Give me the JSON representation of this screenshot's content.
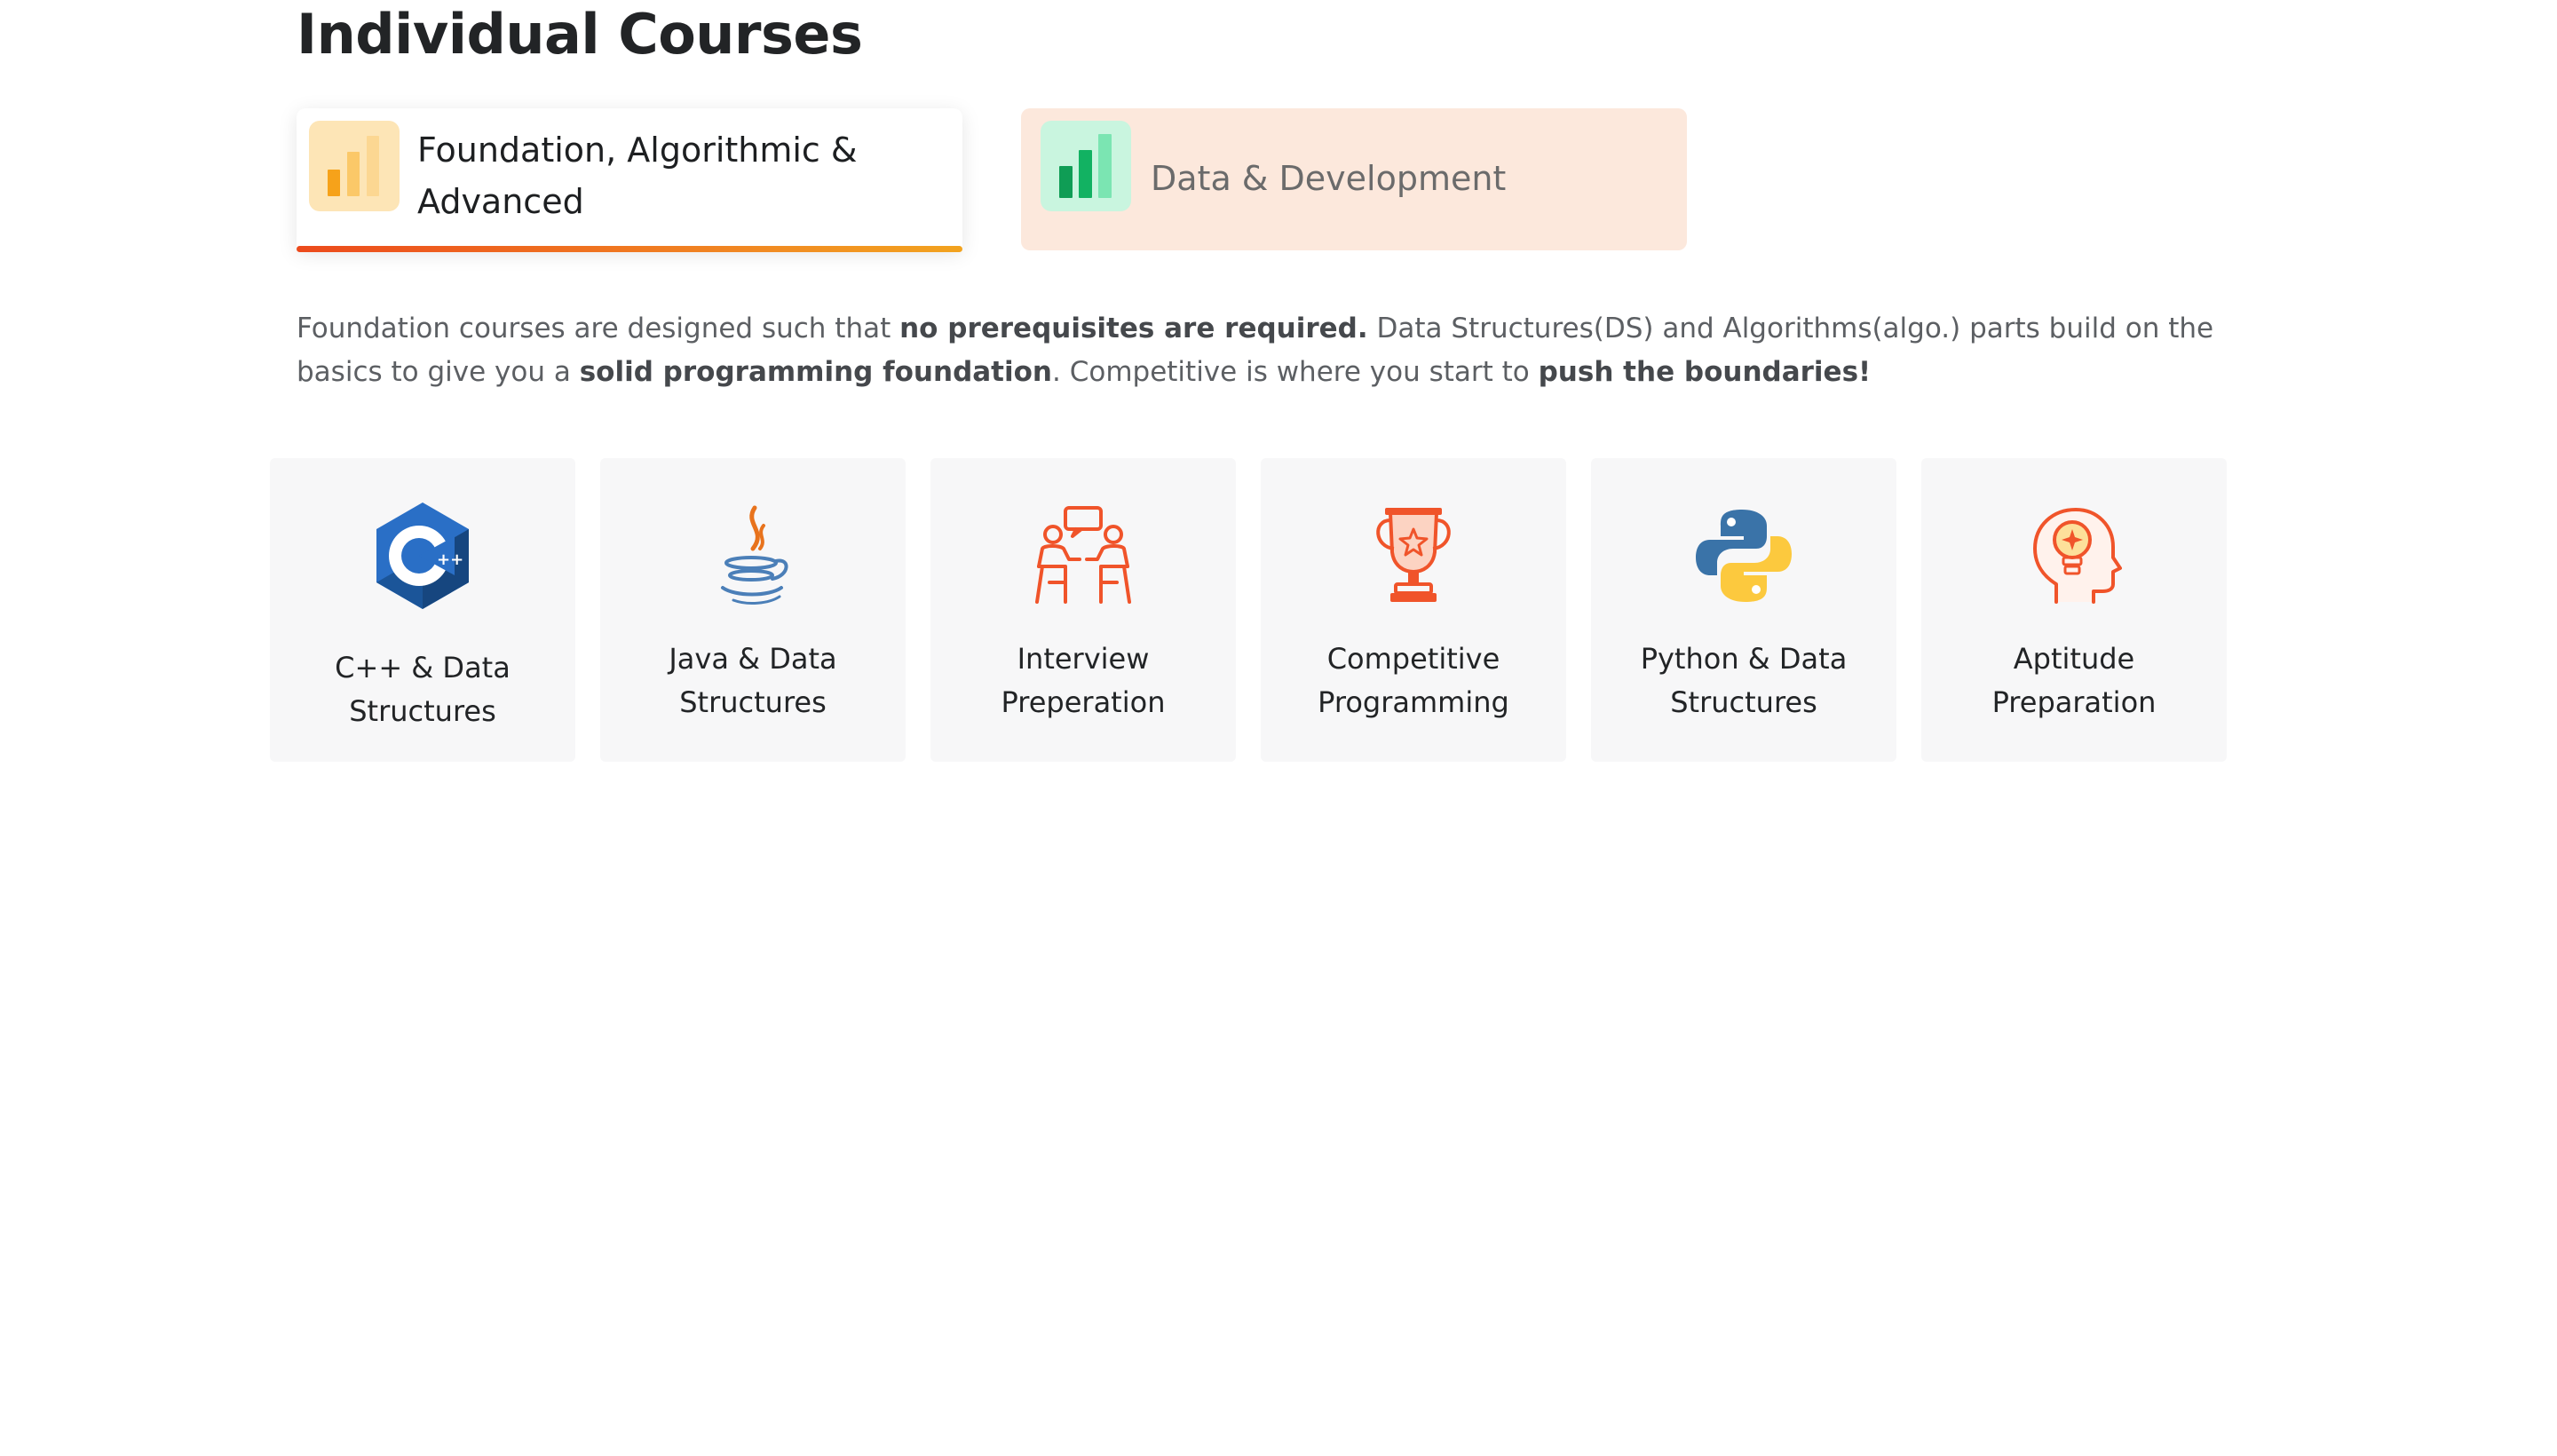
{
  "page": {
    "title": "Individual Courses"
  },
  "tabs": [
    {
      "label": "Foundation, Algorithmic & Advanced",
      "icon": "bar-chart-icon",
      "accent": "#f5a623",
      "active": true
    },
    {
      "label": "Data & Development",
      "icon": "bar-chart-icon",
      "accent": "#15a85a",
      "active": false
    }
  ],
  "description": {
    "p1": "Foundation courses are designed such that ",
    "b1": "no prerequisites are required.",
    "p2": " Data Structures(DS) and Algorithms(algo.) parts build on the basics to give you a ",
    "b2": "solid programming foundation",
    "p3": ". Competitive is where you start to ",
    "b3": "push the boundaries!"
  },
  "courses": [
    {
      "label": "C++ & Data Structures",
      "icon": "cplusplus-logo-icon"
    },
    {
      "label": "Java & Data Structures",
      "icon": "java-logo-icon"
    },
    {
      "label": "Interview Preperation",
      "icon": "interview-people-icon"
    },
    {
      "label": "Competitive Programming",
      "icon": "trophy-icon"
    },
    {
      "label": "Python & Data Structures",
      "icon": "python-logo-icon"
    },
    {
      "label": "Aptitude Preparation",
      "icon": "head-lightbulb-icon"
    }
  ],
  "colors": {
    "accent_orange": "#f0542a",
    "inactive_tab_bg": "#fce8dc",
    "card_bg": "#f7f7f8"
  }
}
